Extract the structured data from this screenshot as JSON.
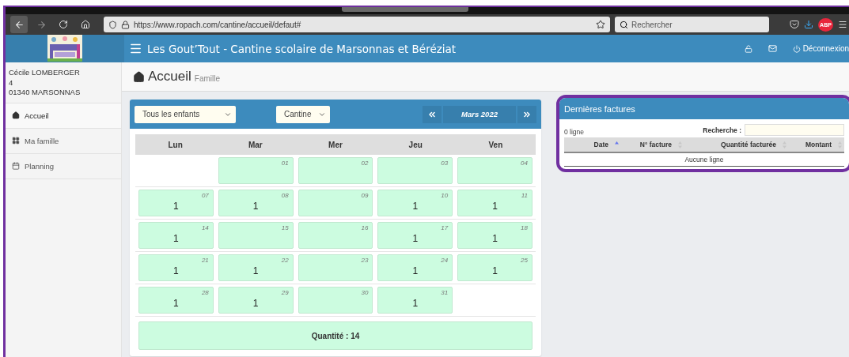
{
  "browser": {
    "url": "https://www.ropach.com/cantine/accueil/defaut#",
    "search_placeholder": "Rechercher",
    "addon_badge": "ABP"
  },
  "header": {
    "title": "Les Gout’Tout - Cantine scolaire de Marsonnas et Béréziat",
    "logout": "Déconnexion"
  },
  "user": {
    "lines": [
      "Cécile LOMBERGER",
      "4",
      "01340 MARSONNAS"
    ]
  },
  "sidebar": {
    "items": [
      {
        "label": "Accueil",
        "kind": "home",
        "selected": true
      },
      {
        "label": "Ma famille",
        "kind": "grid",
        "selected": false
      },
      {
        "label": "Planning",
        "kind": "calendar",
        "selected": false
      }
    ]
  },
  "page": {
    "title": "Accueil",
    "subtitle": "Famille"
  },
  "calendar": {
    "child_select": "Tous les enfants",
    "service_select": "Cantine",
    "month": "Mars 2022",
    "weekdays": [
      "Lun",
      "Mar",
      "Mer",
      "Jeu",
      "Ven"
    ],
    "weeks": [
      [
        {
          "kind": "blank"
        },
        {
          "kind": "day",
          "day": "01"
        },
        {
          "kind": "day",
          "day": "02"
        },
        {
          "kind": "day",
          "day": "03"
        },
        {
          "kind": "day",
          "day": "04"
        }
      ],
      [
        {
          "kind": "day",
          "day": "07",
          "qty": "1"
        },
        {
          "kind": "day",
          "day": "08",
          "qty": "1"
        },
        {
          "kind": "day",
          "day": "09"
        },
        {
          "kind": "day",
          "day": "10",
          "qty": "1"
        },
        {
          "kind": "day",
          "day": "11",
          "qty": "1"
        }
      ],
      [
        {
          "kind": "day",
          "day": "14",
          "qty": "1"
        },
        {
          "kind": "day",
          "day": "15"
        },
        {
          "kind": "day",
          "day": "16"
        },
        {
          "kind": "day",
          "day": "17",
          "qty": "1"
        },
        {
          "kind": "day",
          "day": "18",
          "qty": "1"
        }
      ],
      [
        {
          "kind": "day",
          "day": "21",
          "qty": "1"
        },
        {
          "kind": "day",
          "day": "22",
          "qty": "1"
        },
        {
          "kind": "day",
          "day": "23"
        },
        {
          "kind": "day",
          "day": "24",
          "qty": "1"
        },
        {
          "kind": "day",
          "day": "25",
          "qty": "1"
        }
      ],
      [
        {
          "kind": "day",
          "day": "28",
          "qty": "1"
        },
        {
          "kind": "day",
          "day": "29",
          "qty": "1"
        },
        {
          "kind": "day",
          "day": "30"
        },
        {
          "kind": "day",
          "day": "31",
          "qty": "1"
        },
        {
          "kind": "blank"
        }
      ]
    ],
    "total": "Quantité : 14"
  },
  "invoices": {
    "title": "Dernières factures",
    "count": "0 ligne",
    "search_label": "Recherche :",
    "columns": [
      {
        "label": "Date",
        "sorted": true
      },
      {
        "label": "N° facture",
        "sorted": false
      },
      {
        "label": "Quantité facturée",
        "sorted": false
      },
      {
        "label": "Montant",
        "sorted": false
      }
    ],
    "empty": "Aucune ligne"
  }
}
